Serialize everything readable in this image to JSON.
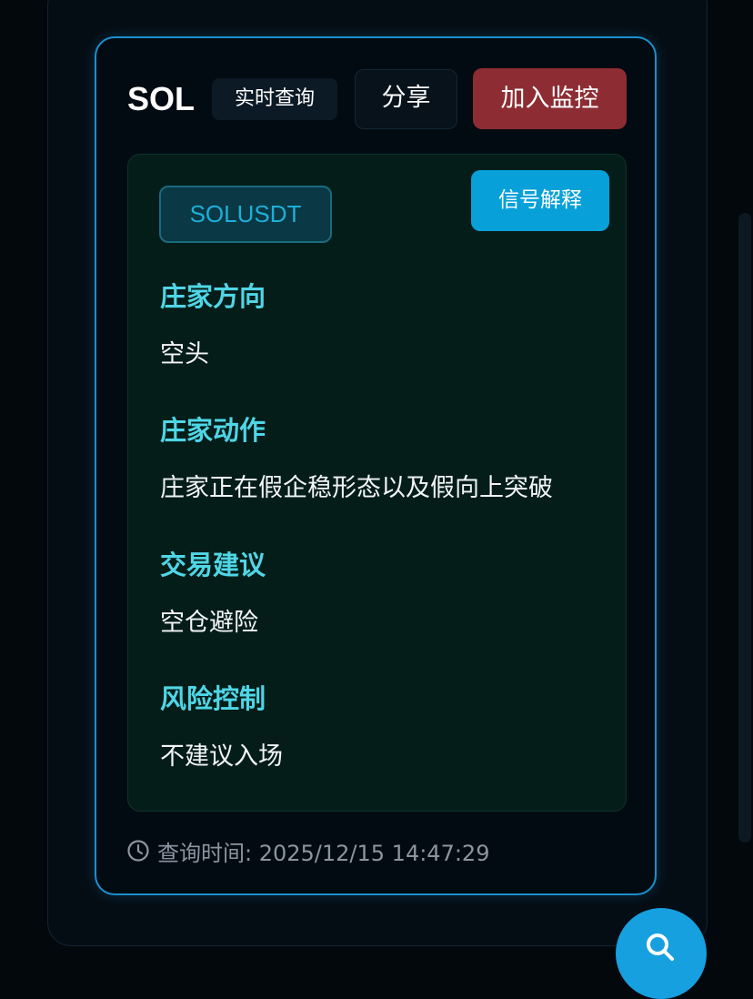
{
  "card": {
    "symbol": "SOL",
    "realtime_label": "实时查询",
    "share_label": "分享",
    "monitor_label": "加入监控",
    "pair": "SOLUSDT",
    "explain_label": "信号解释",
    "sections": [
      {
        "heading": "庄家方向",
        "value": "空头"
      },
      {
        "heading": "庄家动作",
        "value": "庄家正在假企稳形态以及假向上突破"
      },
      {
        "heading": "交易建议",
        "value": "空仓避险"
      },
      {
        "heading": "风险控制",
        "value": "不建议入场"
      }
    ],
    "query_time": "查询时间: 2025/12/15 14:47:29"
  },
  "icons": {
    "clock": "clock-icon",
    "fab": "search-icon"
  },
  "colors": {
    "card_border": "#1c8fcf",
    "heading": "#4fd6e6",
    "monitor_button": "#8d2d33",
    "explain_button": "#08a0d9",
    "pair_text": "#1eaed8",
    "fab": "#16a0e0"
  }
}
